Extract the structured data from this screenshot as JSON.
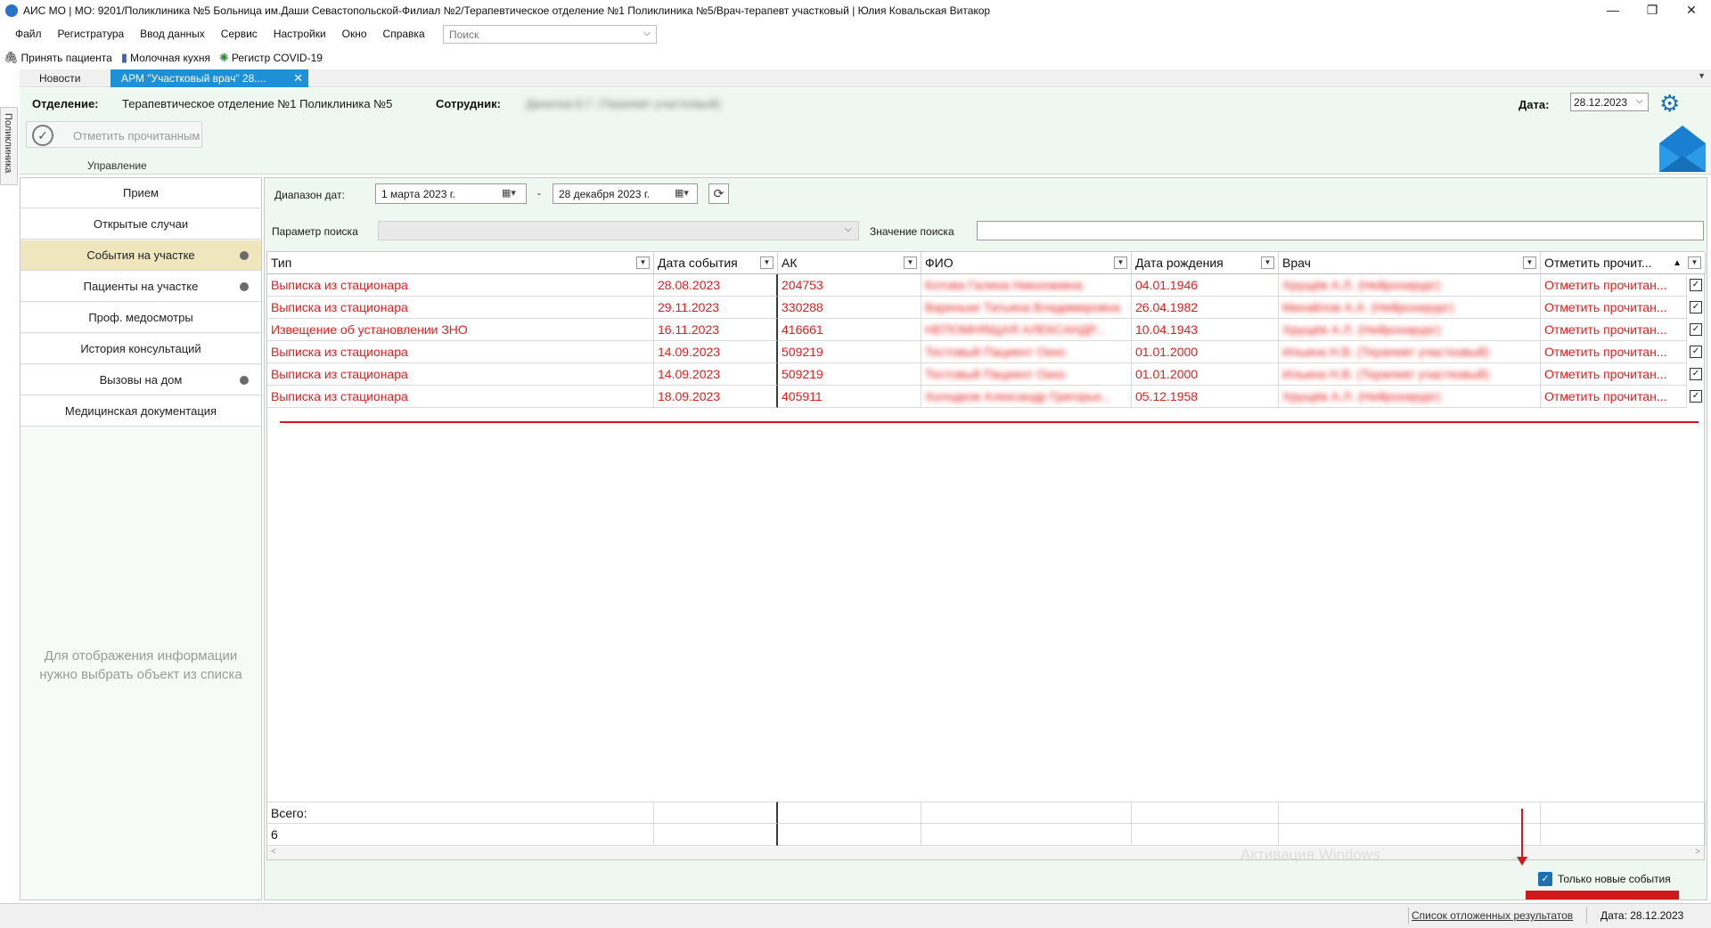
{
  "window": {
    "title": "АИС МО | МО: 9201/Поликлиника №5 Больница им.Даши Севастопольской-Филиал №2/Терапевтическое отделение №1 Поликлиника №5/Врач-терапевт участковый | Юлия Ковальская Витакор",
    "minimize": "—",
    "restore": "❐",
    "close": "✕"
  },
  "menu": [
    "Файл",
    "Регистратура",
    "Ввод данных",
    "Сервис",
    "Настройки",
    "Окно",
    "Справка"
  ],
  "search": {
    "placeholder": "Поиск"
  },
  "toolbar": [
    {
      "label": "Принять пациента",
      "icon": "accept-patient-icon"
    },
    {
      "label": "Молочная кухня",
      "icon": "milk-kitchen-icon"
    },
    {
      "label": "Регистр COVID-19",
      "icon": "covid-icon"
    }
  ],
  "side_vertical_tab": "Поликлиника",
  "tabs": {
    "news": "Новости",
    "active": "АРМ \"Участковый врач\" 28...."
  },
  "header": {
    "department_label": "Отделение:",
    "department_value": "Терапевтическое отделение №1 Поликлиника №5",
    "employee_label": "Сотрудник:",
    "employee_value": "Данилов Е.Г. (Терапевт участковый)",
    "date_label": "Дата:",
    "date_value": "28.12.2023",
    "mark_read": "Отметить прочитанным",
    "management": "Управление"
  },
  "sidebar": {
    "items": [
      {
        "label": "Прием",
        "dot": false
      },
      {
        "label": "Открытые случаи",
        "dot": false
      },
      {
        "label": "События на участке",
        "dot": true,
        "active": true
      },
      {
        "label": "Пациенты на участке",
        "dot": true
      },
      {
        "label": "Проф. медосмотры",
        "dot": false
      },
      {
        "label": "История консультаций",
        "dot": false
      },
      {
        "label": "Вызовы на дом",
        "dot": true
      },
      {
        "label": "Медицинская документация",
        "dot": false
      }
    ],
    "hint_line1": "Для отображения информации",
    "hint_line2": "нужно выбрать объект из списка"
  },
  "filters": {
    "range_label": "Диапазон дат:",
    "date_from": "1   марта    2023 г.",
    "date_to": "28  декабря  2023 г.",
    "dash": "-",
    "param_label": "Параметр поиска",
    "value_label": "Значение поиска"
  },
  "grid": {
    "columns": [
      "Тип",
      "Дата события",
      "АК",
      "ФИО",
      "Дата рождения",
      "Врач",
      "Отметить прочит..."
    ],
    "rows": [
      [
        "Выписка из стационара",
        "28.08.2023",
        "204753",
        "Котова Галина Николаевна",
        "04.01.1946",
        "Хрущёв А.Л. (Нейрохирург)",
        "Отметить прочитан..."
      ],
      [
        "Выписка из стационара",
        "29.11.2023",
        "330288",
        "Вареньке Татьяна Владимировна",
        "26.04.1982",
        "Михайлов А.А. (Нейрохирург)",
        "Отметить прочитан..."
      ],
      [
        "Извещение об установлении ЗНО",
        "16.11.2023",
        "416661",
        "НЕПОМНЯЩАЯ АЛЕКСАНДР...",
        "10.04.1943",
        "Хрущёв А.Л. (Нейрохирург)",
        "Отметить прочитан..."
      ],
      [
        "Выписка из стационара",
        "14.09.2023",
        "509219",
        "Тестовый Пациент Окно",
        "01.01.2000",
        "Ильина Н.В. (Терапевт участковый)",
        "Отметить прочитан..."
      ],
      [
        "Выписка из стационара",
        "14.09.2023",
        "509219",
        "Тестовый Пациент Окно",
        "01.01.2000",
        "Ильина Н.В. (Терапевт участковый)",
        "Отметить прочитан..."
      ],
      [
        "Выписка из стационара",
        "18.09.2023",
        "405911",
        "Холодков Александр Григорье...",
        "05.12.1958",
        "Хрущёв А.Л. (Нейрохирург)",
        "Отметить прочитан..."
      ]
    ],
    "total_label": "Всего:",
    "total_value": "6"
  },
  "only_new": "Только новые события",
  "watermark": "Активация Windows",
  "status": {
    "deferred_link": "Список отложенных результатов",
    "date": "Дата: 28.12.2023"
  },
  "colors": {
    "accent": "#1e90d6",
    "danger": "#e0201e",
    "panel": "#eef8f1",
    "active_item": "#efe6bd"
  }
}
